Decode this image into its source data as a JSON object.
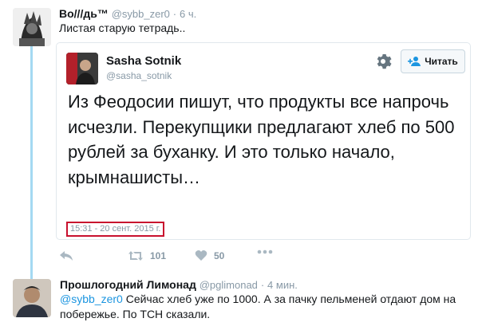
{
  "tweet1": {
    "display_name": "Во///дь™",
    "handle": "@sybb_zer0",
    "time": "6 ч.",
    "text": "Листая старую тетрадь.."
  },
  "quoted": {
    "display_name": "Sasha Sotnik",
    "handle": "@sasha_sotnik",
    "follow_label": "Читать",
    "text": "Из Феодосии пишут, что продукты все напрочь исчезли. Перекупщики предлагают хлеб по 500 рублей за буханку. И это только начало, крымнашисты…",
    "timestamp": "15:31 - 20 сент. 2015 г.",
    "icons": {
      "settings": "gear-icon",
      "follow": "follow-person-icon"
    }
  },
  "actions": {
    "retweet_count": "101",
    "like_count": "50",
    "icons": [
      "reply-icon",
      "retweet-icon",
      "heart-icon",
      "more-icon"
    ]
  },
  "tweet2": {
    "display_name": "Прошлогодний Лимонад",
    "handle": "@pglimonad",
    "time": "4 мин.",
    "mention": "@sybb_zer0",
    "text": "Сейчас хлеб уже по 1000. А за пачку пельменей отдают дом на побережье. По ТСН сказали."
  },
  "colors": {
    "accent": "#1b95e0",
    "muted": "#8899a6",
    "thread_line": "#a4d9f2",
    "timestamp_highlight": "#c8102e"
  }
}
